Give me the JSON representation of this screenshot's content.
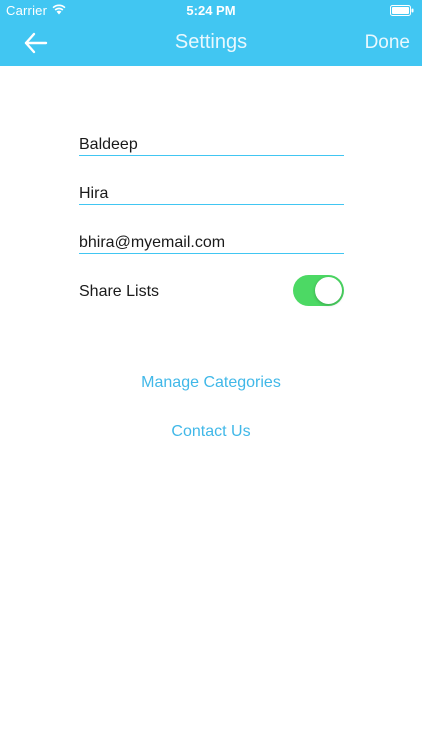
{
  "status_bar": {
    "carrier": "Carrier",
    "time": "5:24 PM",
    "wifi_icon": "wifi-icon",
    "battery_icon": "battery-icon"
  },
  "nav": {
    "back_icon": "arrow-left-icon",
    "title": "Settings",
    "done_label": "Done",
    "background_color": "#41c6f2"
  },
  "form": {
    "first_name": {
      "value": "Baldeep"
    },
    "last_name": {
      "value": "Hira"
    },
    "email": {
      "value": "bhira@myemail.com"
    },
    "share_lists": {
      "label": "Share Lists",
      "enabled": true,
      "on_color": "#4cd964"
    }
  },
  "links": {
    "manage_categories": "Manage Categories",
    "contact_us": "Contact Us",
    "color": "#41b8e8"
  }
}
